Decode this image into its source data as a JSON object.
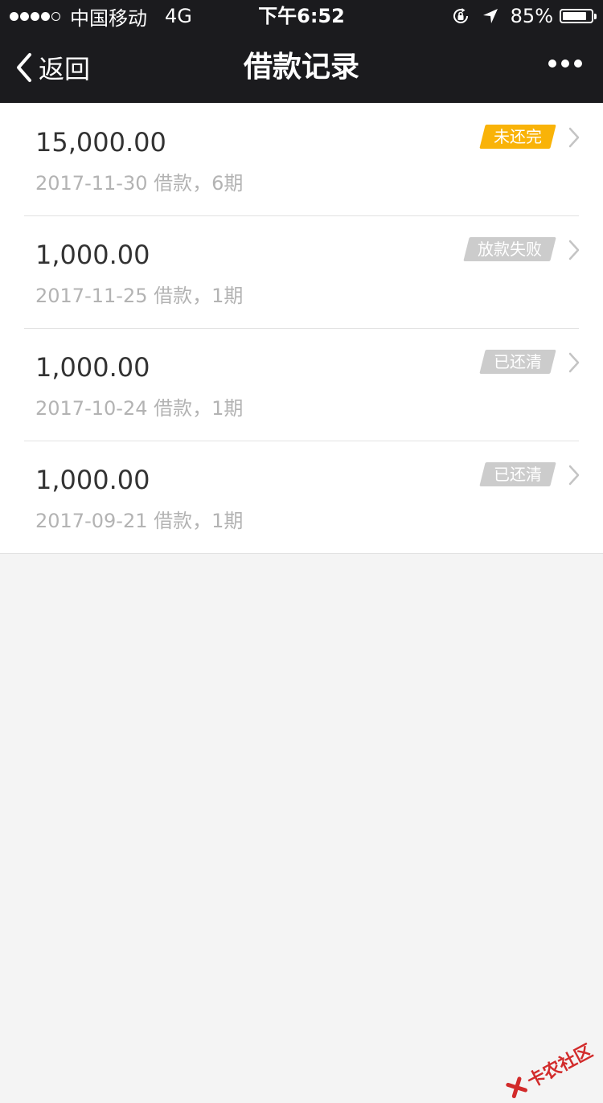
{
  "status_bar": {
    "carrier": "中国移动",
    "network": "4G",
    "time": "下午6:52",
    "battery_percent": "85%",
    "battery_level": 0.85,
    "signal_strength": 4,
    "signal_max": 5
  },
  "nav": {
    "back_label": "返回",
    "title": "借款记录"
  },
  "loans": [
    {
      "amount": "15,000.00",
      "detail": "2017-11-30 借款，6期",
      "status": "未还完",
      "status_color": "#f9b308"
    },
    {
      "amount": "1,000.00",
      "detail": "2017-11-25 借款，1期",
      "status": "放款失败",
      "status_color": "#cccccc"
    },
    {
      "amount": "1,000.00",
      "detail": "2017-10-24 借款，1期",
      "status": "已还清",
      "status_color": "#cccccc"
    },
    {
      "amount": "1,000.00",
      "detail": "2017-09-21 借款，1期",
      "status": "已还清",
      "status_color": "#cccccc"
    }
  ],
  "watermark": {
    "text": "卡农社区"
  },
  "colors": {
    "bar_background": "#1b1b1e",
    "page_background": "#f4f4f4",
    "badge_pending": "#f9b308",
    "badge_inactive": "#cccccc"
  }
}
